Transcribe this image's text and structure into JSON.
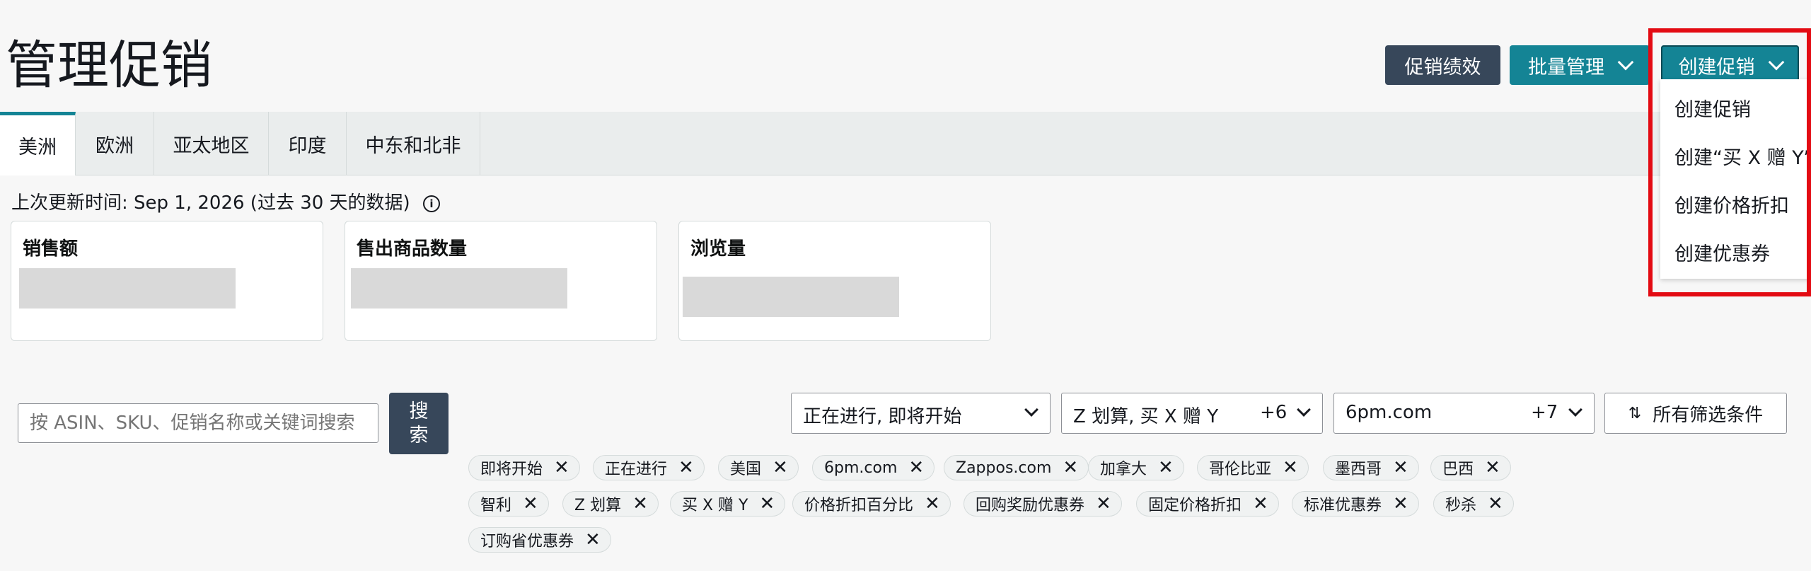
{
  "page": {
    "title": "管理促销"
  },
  "header": {
    "performance_label": "促销绩效",
    "bulk_label": "批量管理",
    "create_label": "创建促销"
  },
  "dropdown": {
    "items": [
      "创建促销",
      "创建“买 X 赠 Y”",
      "创建价格折扣",
      "创建优惠券"
    ]
  },
  "tabs": [
    {
      "label": "美洲",
      "active": true
    },
    {
      "label": "欧洲",
      "active": false
    },
    {
      "label": "亚太地区",
      "active": false
    },
    {
      "label": "印度",
      "active": false
    },
    {
      "label": "中东和北非",
      "active": false
    }
  ],
  "updated": {
    "text": "上次更新时间: Sep 1, 2026 (过去 30 天的数据)"
  },
  "metrics": [
    {
      "title": "销售额"
    },
    {
      "title": "售出商品数量"
    },
    {
      "title": "浏览量"
    }
  ],
  "search": {
    "placeholder": "按 ASIN、SKU、促销名称或关键词搜索",
    "button_line1": "搜",
    "button_line2": "索"
  },
  "filters": {
    "status": {
      "text": "正在进行, 即将开始"
    },
    "type": {
      "text": "Z 划算, 买 X 赠 Y",
      "count": "+6"
    },
    "marketplace": {
      "text": "6pm.com",
      "count": "+7"
    },
    "all_label": "所有筛选条件"
  },
  "chips": {
    "row1": [
      "即将开始",
      "正在进行",
      "美国",
      "6pm.com",
      "Zappos.com",
      "加拿大",
      "哥伦比亚",
      "墨西哥",
      "巴西"
    ],
    "row2": [
      "智利",
      "Z 划算",
      "买 X 赠 Y",
      "价格折扣百分比",
      "回购奖励优惠券",
      "固定价格折扣",
      "标准优惠券",
      "秒杀"
    ],
    "row3": [
      "订购省优惠券"
    ]
  },
  "colors": {
    "teal": "#148495",
    "dark": "#37475a",
    "highlight": "#e30b13"
  }
}
